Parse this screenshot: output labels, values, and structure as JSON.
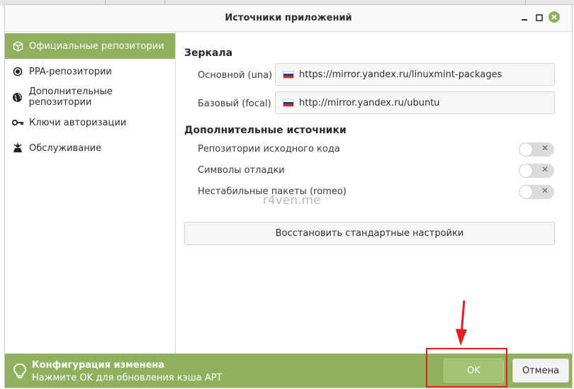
{
  "window": {
    "title": "Источники приложений",
    "controls": [
      "minimize-icon",
      "maximize-icon",
      "close-icon"
    ]
  },
  "sidebar": {
    "items": [
      {
        "label": "Официальные репозитории",
        "icon": "package-icon",
        "active": true
      },
      {
        "label": "PPA-репозитории",
        "icon": "ppa-icon",
        "active": false
      },
      {
        "label": "Дополнительные репозитории",
        "icon": "globe-icon",
        "active": false
      },
      {
        "label": "Ключи авторизации",
        "icon": "key-icon",
        "active": false
      },
      {
        "label": "Обслуживание",
        "icon": "maintenance-icon",
        "active": false
      }
    ]
  },
  "main": {
    "mirrors_title": "Зеркала",
    "mirrors": [
      {
        "label": "Основной (una)",
        "url": "https://mirror.yandex.ru/linuxmint-packages",
        "flag": "ru-flag-icon"
      },
      {
        "label": "Базовый (focal)",
        "url": "http://mirror.yandex.ru/ubuntu",
        "flag": "ru-flag-icon"
      }
    ],
    "extra_title": "Дополнительные источники",
    "toggles": [
      {
        "label": "Репозитории исходного кода",
        "enabled": false
      },
      {
        "label": "Символы отладки",
        "enabled": false
      },
      {
        "label": "Нестабильные пакеты (romeo)",
        "enabled": false
      }
    ],
    "restore_label": "Восстановить стандартные настройки",
    "watermark": "r4ven.me"
  },
  "infobar": {
    "title": "Конфигурация изменена",
    "subtitle": "Нажмите OK для обновления кэша APT",
    "ok_label": "OK",
    "cancel_label": "Отмена",
    "icon": "lightbulb-icon"
  },
  "colors": {
    "accent": "#8fb15e",
    "ok_button": "#a4c274",
    "annotation": "#e41e1e"
  }
}
